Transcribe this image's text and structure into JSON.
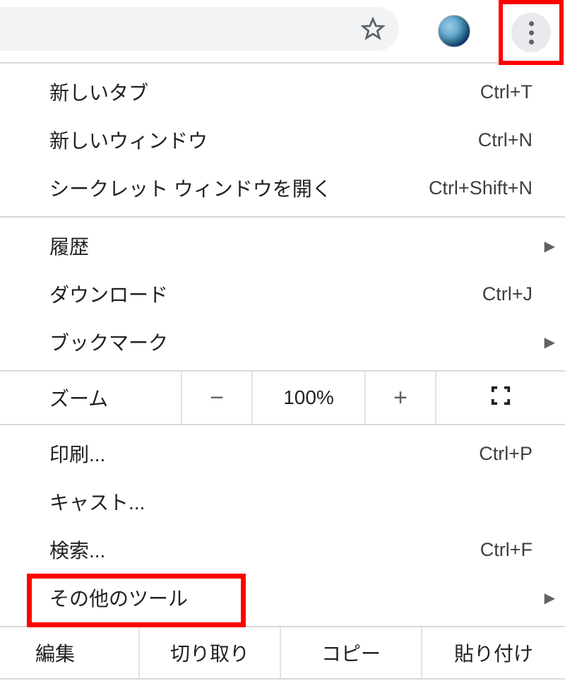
{
  "toolbar": {
    "star_tooltip": "ブックマーク",
    "menu_tooltip": "Google Chrome の設定"
  },
  "menu": {
    "group1": [
      {
        "label": "新しいタブ",
        "shortcut": "Ctrl+T"
      },
      {
        "label": "新しいウィンドウ",
        "shortcut": "Ctrl+N"
      },
      {
        "label": "シークレット ウィンドウを開く",
        "shortcut": "Ctrl+Shift+N"
      }
    ],
    "group2": [
      {
        "label": "履歴",
        "submenu": true
      },
      {
        "label": "ダウンロード",
        "shortcut": "Ctrl+J"
      },
      {
        "label": "ブックマーク",
        "submenu": true
      }
    ],
    "zoom": {
      "label": "ズーム",
      "minus": "−",
      "value": "100%",
      "plus": "+"
    },
    "group3": [
      {
        "label": "印刷...",
        "shortcut": "Ctrl+P"
      },
      {
        "label": "キャスト..."
      },
      {
        "label": "検索...",
        "shortcut": "Ctrl+F"
      },
      {
        "label": "その他のツール",
        "submenu": true
      }
    ],
    "edit": {
      "label": "編集",
      "cut": "切り取り",
      "copy": "コピー",
      "paste": "貼り付け"
    }
  }
}
